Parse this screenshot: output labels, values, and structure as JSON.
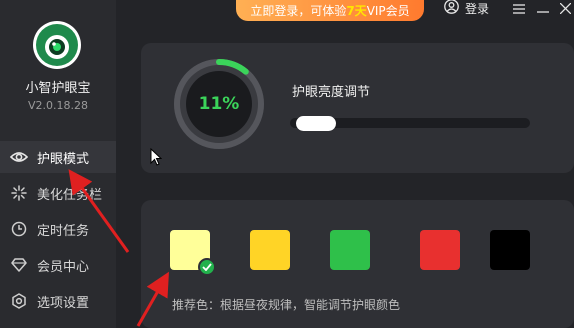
{
  "app": {
    "name": "小智护眼宝",
    "version": "V2.0.18.28"
  },
  "topbar": {
    "promo_prefix": "立即登录，可体验",
    "promo_highlight": "7天",
    "promo_suffix": "VIP会员",
    "login_label": "登录"
  },
  "sidebar": {
    "items": [
      {
        "label": "护眼模式",
        "icon": "eye-icon",
        "active": true
      },
      {
        "label": "美化任务栏",
        "icon": "sparkle-icon",
        "active": false
      },
      {
        "label": "定时任务",
        "icon": "clock-icon",
        "active": false
      },
      {
        "label": "会员中心",
        "icon": "diamond-icon",
        "active": false
      },
      {
        "label": "选项设置",
        "icon": "settings-icon",
        "active": false
      }
    ]
  },
  "brightness": {
    "value_label": "11%",
    "value": 0.11,
    "title": "护眼亮度调节",
    "slider_value": 0.12
  },
  "colors": {
    "swatches": [
      {
        "name": "light-yellow",
        "hex": "#ffff99",
        "selected": true
      },
      {
        "name": "yellow",
        "hex": "#ffd426",
        "selected": false
      },
      {
        "name": "green",
        "hex": "#2fc04a",
        "selected": false
      },
      {
        "name": "red",
        "hex": "#e8302f",
        "selected": false
      },
      {
        "name": "black",
        "hex": "#000000",
        "selected": false
      }
    ],
    "tip": "推荐色：根据昼夜规律，智能调节护眼颜色"
  },
  "theme": {
    "accent_green": "#3bd45a",
    "arrow_red": "#e02020",
    "promo_orange": "#ff8a3a"
  }
}
